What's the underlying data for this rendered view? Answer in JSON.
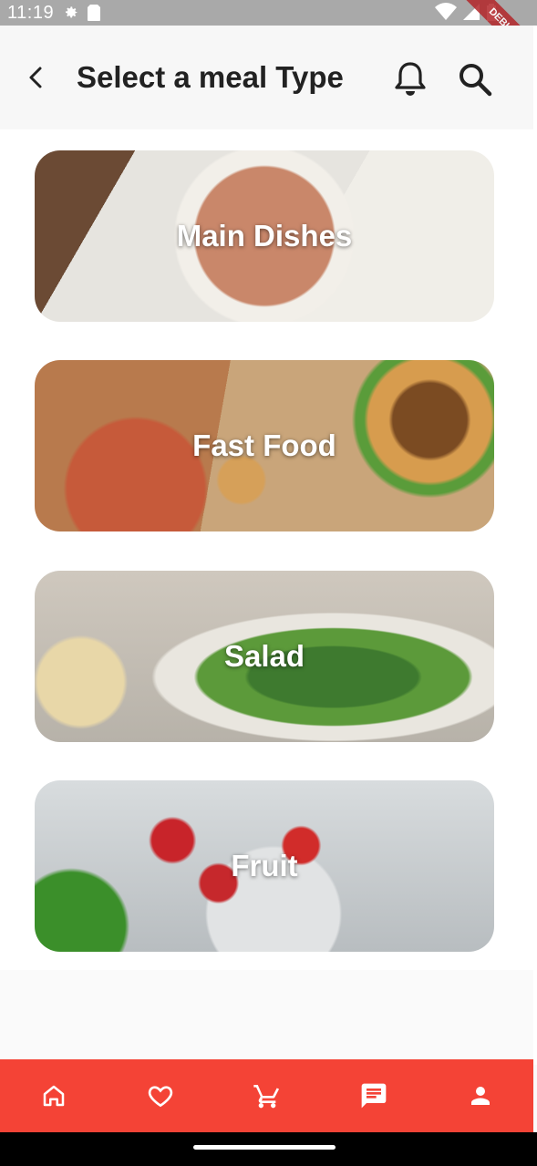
{
  "status": {
    "time": "11:19",
    "debug_banner": "DEBUG"
  },
  "appbar": {
    "title": "Select a meal Type"
  },
  "meals": [
    {
      "label": "Main Dishes"
    },
    {
      "label": "Fast Food"
    },
    {
      "label": "Salad"
    },
    {
      "label": "Fruit"
    }
  ],
  "nav": [
    "home-icon",
    "favorite-icon",
    "cart-icon",
    "chat-icon",
    "profile-icon"
  ],
  "colors": {
    "navbar": "#f44336",
    "statusbar": "#a9a9a9"
  }
}
